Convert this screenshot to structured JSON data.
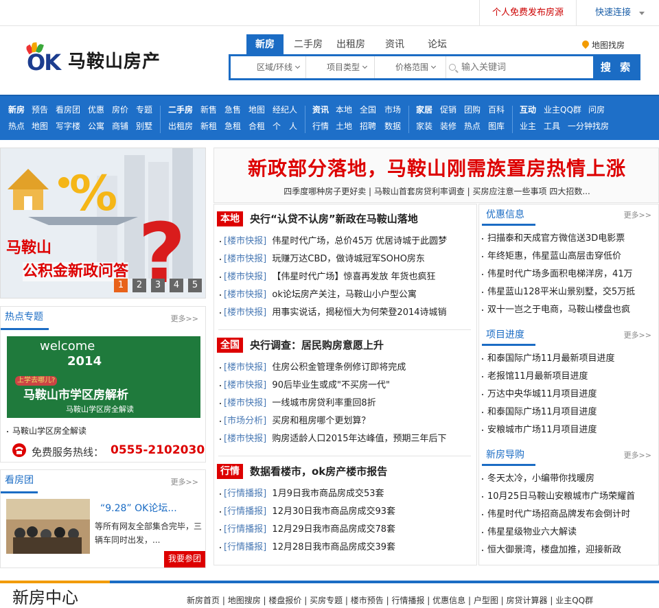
{
  "topbar": {
    "publish": "个人免费发布房源",
    "quick": "快速连接"
  },
  "logo": {
    "mark": "OK",
    "name": "马鞍山房产"
  },
  "search": {
    "tabs": [
      "新房",
      "二手房",
      "出租房",
      "资讯",
      "论坛"
    ],
    "map_link": "地图找房",
    "selects": [
      "区域/环线",
      "项目类型",
      "价格范围"
    ],
    "placeholder": "输入关键词",
    "button": "搜 索"
  },
  "nav": {
    "groups": [
      {
        "row1": [
          "新房",
          "预告",
          "看房团",
          "优惠",
          "房价",
          "专题"
        ],
        "row2": [
          "热点",
          "地图",
          "写字楼",
          "公寓",
          "商铺",
          "别墅"
        ]
      },
      {
        "row1": [
          "二手房",
          "新售",
          "急售",
          "地图",
          "经纪人"
        ],
        "row2": [
          "出租房",
          "新租",
          "急租",
          "合租",
          "个",
          "人"
        ]
      },
      {
        "row1": [
          "资讯",
          "本地",
          "全国",
          "市场"
        ],
        "row2": [
          "行情",
          "土地",
          "招聘",
          "数据"
        ]
      },
      {
        "row1": [
          "家居",
          "促销",
          "团购",
          "百科"
        ],
        "row2": [
          "家装",
          "装修",
          "热点",
          "图库"
        ]
      },
      {
        "row1": [
          "互动",
          "业主QQ群",
          "问房"
        ],
        "row2": [
          "业主",
          "工具",
          "一分钟找房"
        ]
      }
    ]
  },
  "banner": {
    "line1": "马鞍山",
    "line2": "公积金新政问答",
    "pages": [
      "1",
      "2",
      "3",
      "4",
      "5"
    ]
  },
  "headline": {
    "title": "新政部分落地，马鞍山刚需族置房热情上涨",
    "sub": "四季度哪种房子更好卖  |  马鞍山首套房贷利率调查  |  买房应注意一些事项 四大招数..."
  },
  "hot": {
    "title": "热点专题",
    "more": "更多>>",
    "img_text1": "welcome",
    "img_text2": "2014",
    "img_text3": "马鞍山市学区房解析",
    "img_text4": "马鞍山学区房全解读",
    "img_text5": "上学去哪儿?",
    "item": "马鞍山学区房全解读",
    "hotline_label": "免费服务热线：",
    "hotline": "0555-2102030"
  },
  "tour": {
    "title": "看房团",
    "more": "更多>>",
    "headline": "“9.28” OK论坛...",
    "desc": "等所有网友全部集合完毕，三辆车同时出发，...",
    "button": "我要参团"
  },
  "news": {
    "sections": [
      {
        "tag": "本地",
        "title": "央行“认贷不认房”新政在马鞍山落地",
        "items": [
          {
            "cat": "[楼市快报]",
            "text": "伟星时代广场，总价45万 优居诗城于此圆梦"
          },
          {
            "cat": "[楼市快报]",
            "text": "玩赚万达CBD，做诗城冠军SOHO房东"
          },
          {
            "cat": "[楼市快报]",
            "text": "【伟星时代广场】惊喜再发放 年货也疯狂"
          },
          {
            "cat": "[楼市快报]",
            "text": "ok论坛房产关注，马鞍山小户型公寓"
          },
          {
            "cat": "[楼市快报]",
            "text": "用事实说话，揭秘恒大为何荣登2014诗城销"
          }
        ]
      },
      {
        "tag": "全国",
        "title": "央行调查：居民购房意愿上升",
        "items": [
          {
            "cat": "[楼市快报]",
            "text": "住房公积金管理条例修订即将完成"
          },
          {
            "cat": "[楼市快报]",
            "text": "90后毕业生或成\"不买房一代\""
          },
          {
            "cat": "[楼市快报]",
            "text": "一线城市房贷利率重回8折"
          },
          {
            "cat": "[市场分析]",
            "text": "买房和租房哪个更划算？"
          },
          {
            "cat": "[楼市快报]",
            "text": "购房适龄人口2015年达峰值，预期三年后下"
          }
        ]
      },
      {
        "tag": "行情",
        "title": "数据看楼市，ok房产楼市报告",
        "items": [
          {
            "cat": "[行情播报]",
            "text": "1月9日我市商品房成交53套"
          },
          {
            "cat": "[行情播报]",
            "text": "12月30日我市商品房成交93套"
          },
          {
            "cat": "[行情播报]",
            "text": "12月29日我市商品房成交78套"
          },
          {
            "cat": "[行情播报]",
            "text": "12月28日我市商品房成交39套"
          }
        ]
      }
    ]
  },
  "right": {
    "sections": [
      {
        "title": "优惠信息",
        "more": "更多>>",
        "items": [
          "扫描泰和天成官方微信送3D电影票",
          "年终矩惠，伟星蓝山高层击穿低价",
          "伟星时代广场多面积电梯洋房，41万",
          "伟星蓝山128平米山景别墅，交5万抵",
          "双十一岂之于电商，马鞍山楼盘也疯"
        ]
      },
      {
        "title": "项目进度",
        "more": "更多>>",
        "items": [
          "和泰国际广场11月最新项目进度",
          "老报馆11月最新项目进度",
          "万达中央华城11月项目进度",
          "和泰国际广场11月项目进度",
          "安粮城市广场11月项目进度"
        ]
      },
      {
        "title": "新房导购",
        "more": "更多>>",
        "items": [
          "冬天太冷，小编带你找暖房",
          "10月25日马鞍山安粮城市广场荣耀首",
          "伟星时代广场招商品牌发布会倒计时",
          "伟星星级物业六大解读",
          "恒大御景湾，楼盘加推，迎接新政"
        ]
      }
    ]
  },
  "footer": {
    "title": "新房中心",
    "links": [
      "新房首页",
      "地图搜房",
      "楼盘报价",
      "买房专题",
      "楼市预告",
      "行情播报",
      "优惠信息",
      "户型图",
      "房贷计算器",
      "业主QQ群"
    ]
  },
  "colors": {
    "brand_blue": "#1b6cc4",
    "accent_red": "#dd0000",
    "nav_bg": "#1e6fc8"
  }
}
